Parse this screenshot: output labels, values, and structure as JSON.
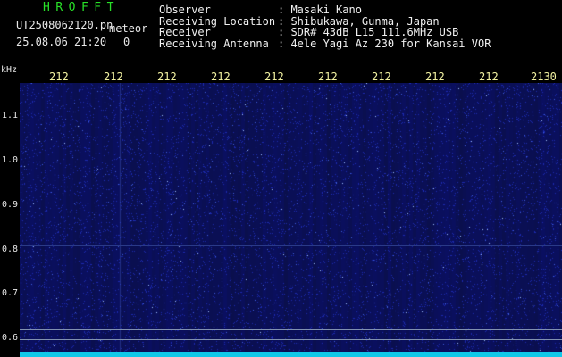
{
  "app": {
    "title": "HROFFT"
  },
  "file": {
    "name": "UT2508062120.pn",
    "meteor_label": "meteor",
    "date_time": "25.08.06 21:20",
    "meteor_count": "0"
  },
  "info": {
    "observer_label": "Observer",
    "observer": "Masaki Kano",
    "location_label": "Receiving Location",
    "location": "Shibukawa, Gunma, Japan",
    "receiver_label": "Receiver",
    "receiver": "SDR# 43dB L15 111.6MHz USB",
    "antenna_label": "Receiving Antenna",
    "antenna": "4ele Yagi Az 230 for Kansai VOR"
  },
  "axis": {
    "y_unit": "kHz",
    "y_ticks": [
      "1.1",
      "1.0",
      "0.9",
      "0.8",
      "0.7",
      "0.6"
    ],
    "x_ticks": [
      "212",
      "212",
      "212",
      "212",
      "212",
      "212",
      "212",
      "212",
      "212"
    ],
    "x_end": "2130"
  },
  "colors": {
    "title": "#28e028",
    "background": "#000000",
    "waterfall": "#060848",
    "noise_floor": "#10c8e8",
    "time_ticks": "#f0f0a0"
  }
}
